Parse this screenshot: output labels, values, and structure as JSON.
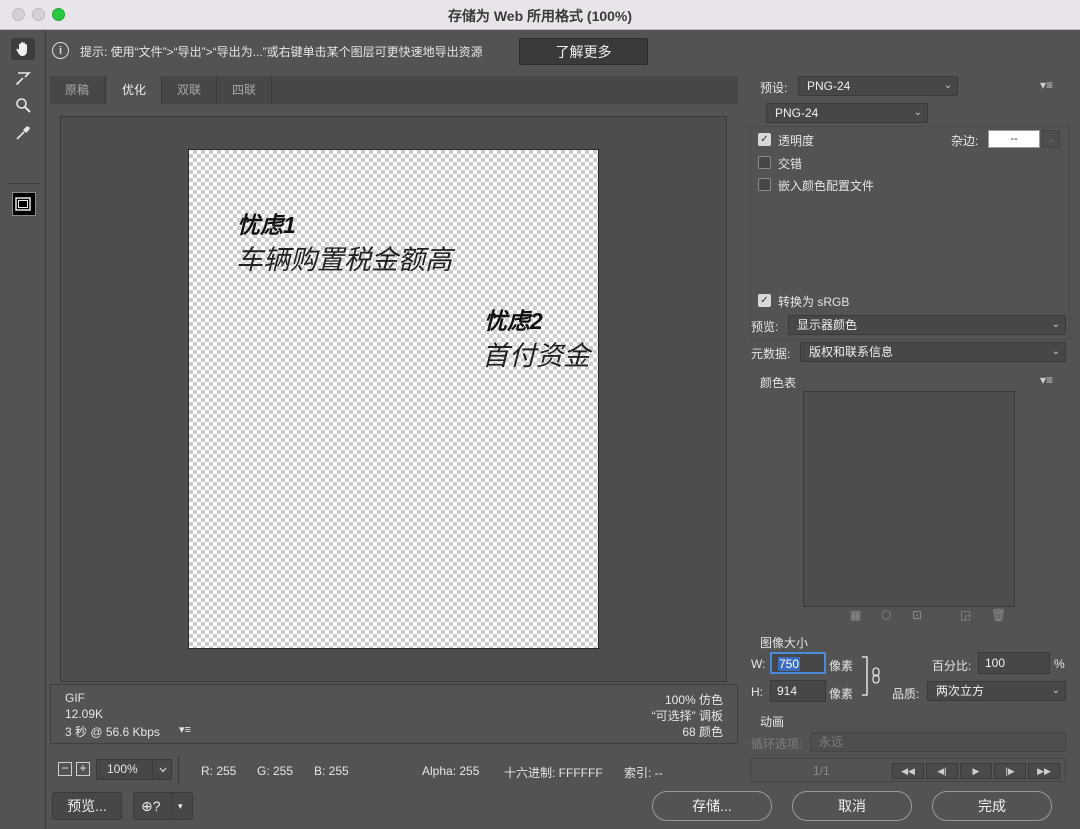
{
  "window": {
    "title": "存储为 Web 所用格式 (100%)"
  },
  "tools": [
    "hand-tool",
    "slice-select-tool",
    "zoom-tool",
    "eyedropper-tool",
    "eyedropper-color",
    "toggle-slices"
  ],
  "hint": {
    "icon": "i",
    "text": "提示: 使用“文件”>“导出”>“导出为...”或右键单击某个图层可更快速地导出资源",
    "learn_more": "了解更多"
  },
  "tabs": [
    "原稿",
    "优化",
    "双联",
    "四联"
  ],
  "active_tab": "优化",
  "artwork": {
    "worry1_title": "忧虑1",
    "worry1_text": "车辆购置税金额高",
    "worry2_title": "忧虑2",
    "worry2_text": "首付资金"
  },
  "info": {
    "format": "GIF",
    "size": "12.09K",
    "time": "3 秒 @ 56.6 Kbps",
    "dither": "100% 仿色",
    "palette": "“可选择” 调板",
    "colors": "68 颜色"
  },
  "status": {
    "zoom_minus": "−",
    "zoom_plus": "+",
    "zoom": "100%",
    "r": "R: 255",
    "g": "G: 255",
    "b": "B: 255",
    "alpha": "Alpha: 255",
    "hex": "十六进制: FFFFFF",
    "index": "索引: --"
  },
  "buttons": {
    "preview": "预览...",
    "save": "存储...",
    "cancel": "取消",
    "done": "完成"
  },
  "settings": {
    "preset_label": "预设:",
    "preset": "PNG-24",
    "format": "PNG-24",
    "transparency": "透明度",
    "transparency_checked": true,
    "matte_label": "杂边:",
    "matte": "--",
    "interlaced": "交错",
    "interlaced_checked": false,
    "embed_profile": "嵌入颜色配置文件",
    "embed_profile_checked": false,
    "convert_srgb": "转换为 sRGB",
    "convert_srgb_checked": true,
    "preview_label": "预览:",
    "preview": "显示器颜色",
    "metadata_label": "元数据:",
    "metadata": "版权和联系信息",
    "color_table_label": "颜色表"
  },
  "image_size": {
    "label": "图像大小",
    "w_label": "W:",
    "w": "750",
    "h_label": "H:",
    "h": "914",
    "unit": "像素",
    "percent_label": "百分比:",
    "percent": "100",
    "percent_sign": "%",
    "quality_label": "品质:",
    "quality": "两次立方"
  },
  "animation": {
    "label": "动画",
    "loop_label": "循环选项:",
    "loop": "永远",
    "frame": "1/1"
  },
  "colors": {
    "window_bg": "#535353",
    "accent_focus": "#4a8ad8",
    "close_green": "#2ac842"
  }
}
